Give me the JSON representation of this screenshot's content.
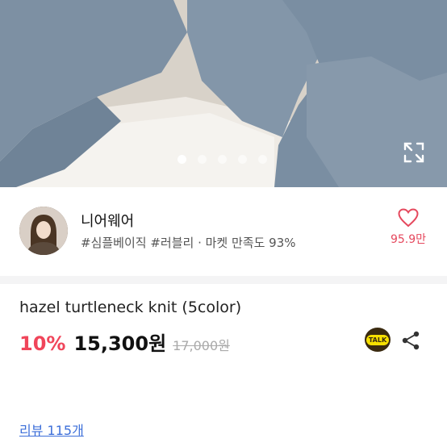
{
  "gallery": {
    "slide_count": 5,
    "active_index": 0
  },
  "seller": {
    "name": "니어웨어",
    "tags": "#심플베이직 #러블리 · 마켓 만족도 93%",
    "likes": "95.9만"
  },
  "product": {
    "title": "hazel turtleneck knit (5color)",
    "discount": "10%",
    "price": "15,300원",
    "original_price": "17,000원",
    "talk_label": "TALK"
  },
  "review": {
    "link": "리뷰 115개"
  },
  "colors": {
    "accent": "#f0455a",
    "like": "#e5485d",
    "link": "#3d6fd9",
    "knit": "#7f93a6"
  },
  "icons": [
    "expand-icon",
    "heart-icon",
    "kakao-talk-icon",
    "share-icon"
  ]
}
